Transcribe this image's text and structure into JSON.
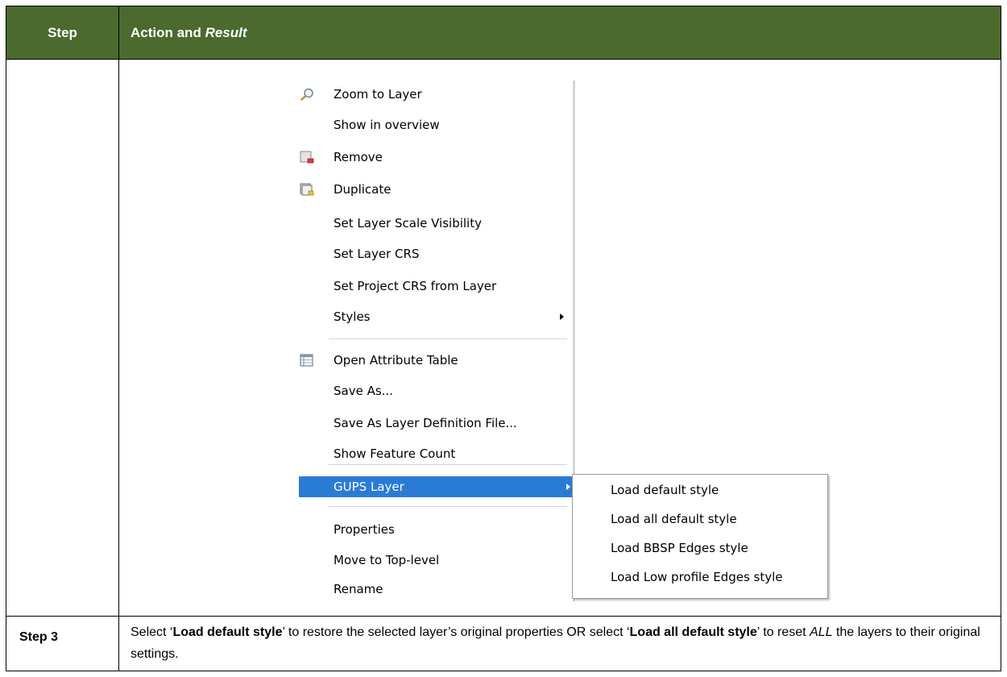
{
  "table": {
    "header": {
      "step": "Step",
      "action": "Action and ",
      "result": "Result"
    }
  },
  "context_menu": {
    "items": [
      {
        "label": "Zoom to Layer",
        "icon": "zoom-icon"
      },
      {
        "label": "Show in overview"
      },
      {
        "label": "Remove",
        "icon": "remove-layer-icon"
      },
      {
        "label": "Duplicate",
        "icon": "duplicate-layer-icon"
      },
      {
        "label": "Set Layer Scale Visibility"
      },
      {
        "label": "Set Layer CRS"
      },
      {
        "label": "Set Project CRS from Layer"
      },
      {
        "label": "Styles",
        "has_submenu": true
      },
      {
        "label": "Open Attribute Table",
        "icon": "attribute-table-icon"
      },
      {
        "label": "Save As..."
      },
      {
        "label": "Save As Layer Definition File..."
      },
      {
        "label": "Show Feature Count"
      },
      {
        "label": "GUPS Layer",
        "has_submenu": true,
        "highlighted": true
      },
      {
        "label": "Properties"
      },
      {
        "label": "Move to Top-level"
      },
      {
        "label": "Rename"
      }
    ],
    "highlight_color": "#2a7bd6"
  },
  "submenu": {
    "items": [
      {
        "label": "Load default style"
      },
      {
        "label": "Load all default style"
      },
      {
        "label": "Load BBSP Edges style"
      },
      {
        "label": "Load Low profile Edges style"
      }
    ]
  },
  "step_row": {
    "step": "Step 3",
    "text": {
      "p1": "Select ‘",
      "b1": "Load default style",
      "p2": "’ to restore the selected layer’s original properties OR select ‘",
      "b2": "Load all default style",
      "p3": "’ to reset ",
      "i1": "ALL",
      "p4": " the layers to their original settings."
    }
  },
  "colors": {
    "header_bg": "#4a6a2e",
    "header_text": "#ffffff"
  }
}
